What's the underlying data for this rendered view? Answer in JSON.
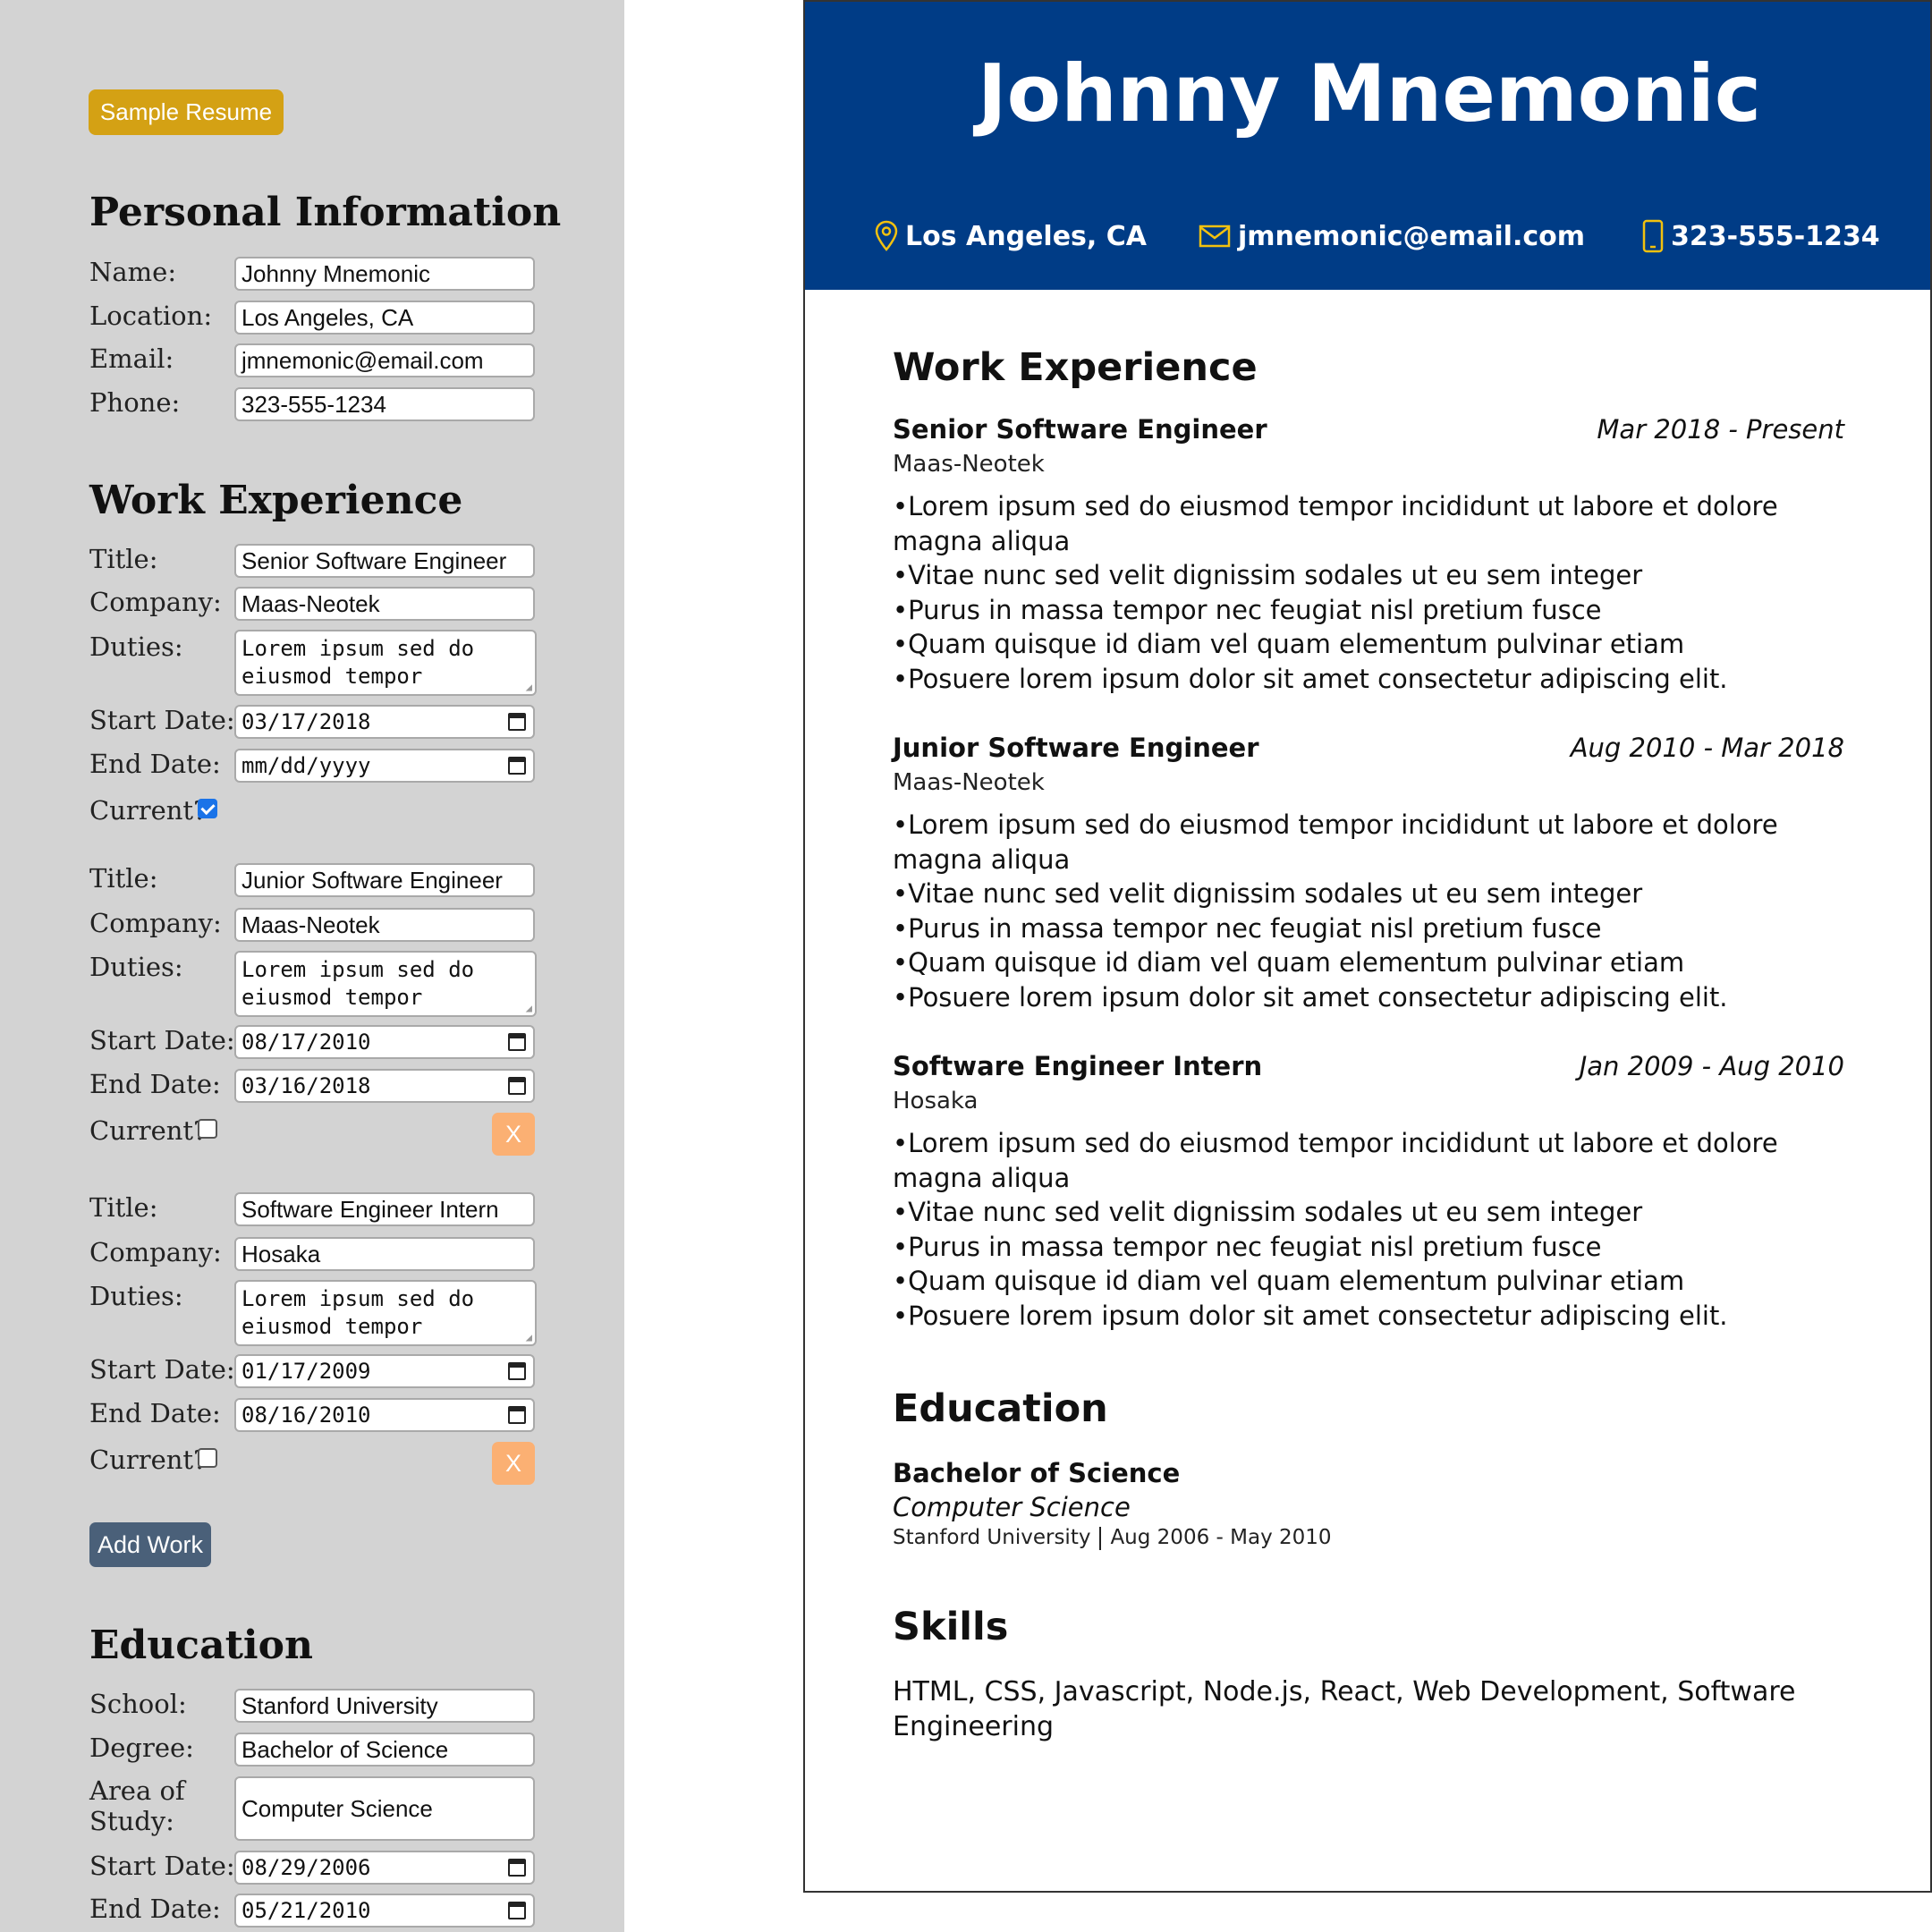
{
  "editor": {
    "sample_button": "Sample Resume",
    "personal": {
      "heading": "Personal Information",
      "name_label": "Name:",
      "name_value": "Johnny Mnemonic",
      "location_label": "Location:",
      "location_value": "Los Angeles, CA",
      "email_label": "Email:",
      "email_value": "jmnemonic@email.com",
      "phone_label": "Phone:",
      "phone_value": "323-555-1234"
    },
    "work": {
      "heading": "Work Experience",
      "title_label": "Title:",
      "company_label": "Company:",
      "duties_label": "Duties:",
      "start_label": "Start Date:",
      "end_label": "End Date:",
      "current_label": "Current?",
      "remove_label": "X",
      "add_button": "Add Work",
      "entries": [
        {
          "title": "Senior Software Engineer",
          "company": "Maas-Neotek",
          "duties": "Lorem ipsum sed do eiusmod tempor",
          "start": "03/17/2018",
          "end": "mm/dd/yyyy",
          "current": true
        },
        {
          "title": "Junior Software Engineer",
          "company": "Maas-Neotek",
          "duties": "Lorem ipsum sed do eiusmod tempor",
          "start": "08/17/2010",
          "end": "03/16/2018",
          "current": false
        },
        {
          "title": "Software Engineer Intern",
          "company": "Hosaka",
          "duties": "Lorem ipsum sed do eiusmod tempor",
          "start": "01/17/2009",
          "end": "08/16/2010",
          "current": false
        }
      ]
    },
    "education": {
      "heading": "Education",
      "school_label": "School:",
      "school_value": "Stanford University",
      "degree_label": "Degree:",
      "degree_value": "Bachelor of Science",
      "area_label_1": "Area of",
      "area_label_2": "Study:",
      "area_value": "Computer Science",
      "start_label": "Start Date:",
      "start_value": "08/29/2006",
      "end_label": "End Date:",
      "end_value": "05/21/2010"
    }
  },
  "resume": {
    "name": "Johnny Mnemonic",
    "location": "Los Angeles, CA",
    "email": "jmnemonic@email.com",
    "phone": "323-555-1234",
    "work_heading": "Work Experience",
    "jobs": [
      {
        "title": "Senior Software Engineer",
        "dates": "Mar 2018 - Present",
        "company": "Maas-Neotek",
        "duties": [
          "Lorem ipsum sed do eiusmod tempor incididunt ut labore et dolore magna aliqua",
          "Vitae nunc sed velit dignissim sodales ut eu sem integer",
          "Purus in massa tempor nec feugiat nisl pretium fusce",
          "Quam quisque id diam vel quam elementum pulvinar etiam",
          "Posuere lorem ipsum dolor sit amet consectetur adipiscing elit."
        ]
      },
      {
        "title": "Junior Software Engineer",
        "dates": "Aug 2010 - Mar 2018",
        "company": "Maas-Neotek",
        "duties": [
          "Lorem ipsum sed do eiusmod tempor incididunt ut labore et dolore magna aliqua",
          "Vitae nunc sed velit dignissim sodales ut eu sem integer",
          "Purus in massa tempor nec feugiat nisl pretium fusce",
          "Quam quisque id diam vel quam elementum pulvinar etiam",
          "Posuere lorem ipsum dolor sit amet consectetur adipiscing elit."
        ]
      },
      {
        "title": "Software Engineer Intern",
        "dates": "Jan 2009 - Aug 2010",
        "company": "Hosaka",
        "duties": [
          "Lorem ipsum sed do eiusmod tempor incididunt ut labore et dolore magna aliqua",
          "Vitae nunc sed velit dignissim sodales ut eu sem integer",
          "Purus in massa tempor nec feugiat nisl pretium fusce",
          "Quam quisque id diam vel quam elementum pulvinar etiam",
          "Posuere lorem ipsum dolor sit amet consectetur adipiscing elit."
        ]
      }
    ],
    "education_heading": "Education",
    "degree": "Bachelor of Science",
    "area": "Computer Science",
    "school": "Stanford University",
    "edu_dates": "Aug 2006 - May 2010",
    "skills_heading": "Skills",
    "skills": "HTML, CSS, Javascript, Node.js, React, Web Development, Software Engineering"
  },
  "colors": {
    "header_bg": "#003c86",
    "icon_accent": "#f2c10f",
    "sample_button": "#d4a114",
    "remove_button": "#fbb073",
    "add_button": "#4a6079",
    "panel_bg": "#d3d3d3"
  },
  "icons": {
    "location": "map-pin-icon",
    "email": "envelope-icon",
    "phone": "smartphone-icon",
    "calendar": "calendar-icon"
  }
}
